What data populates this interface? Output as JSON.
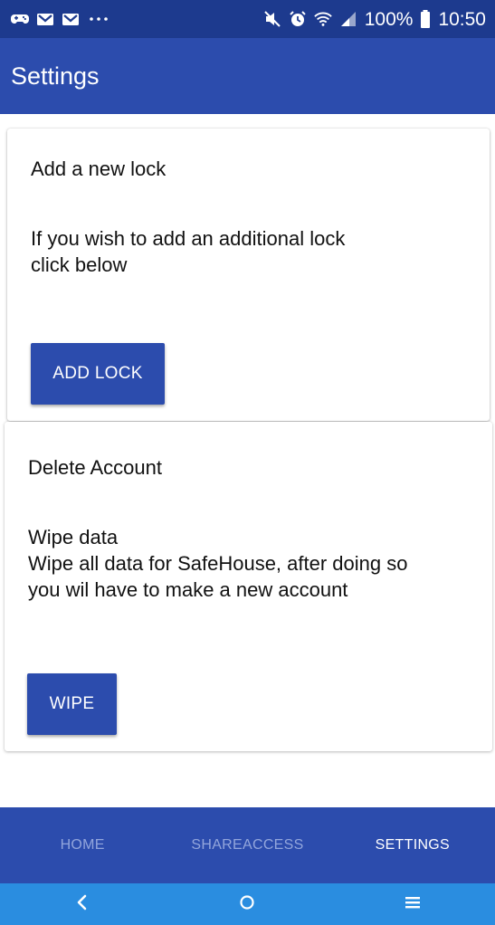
{
  "status_bar": {
    "left_icons": [
      "game-controller-icon",
      "gmail-icon",
      "gmail-icon",
      "more-notifications-icon"
    ],
    "right_icons": [
      "mute-icon",
      "alarm-icon",
      "wifi-icon",
      "signal-icon",
      "battery-icon"
    ],
    "battery": "100%",
    "time": "10:50"
  },
  "app_bar": {
    "title": "Settings"
  },
  "lock_card": {
    "heading": "Add a new lock",
    "body_line1": "If you wish to add an additional lock",
    "body_line2": "click below",
    "button_label": "ADD LOCK"
  },
  "delete_card": {
    "heading": "Delete Account",
    "subheading": "Wipe data",
    "body_line1": "Wipe all data for SafeHouse, after doing so",
    "body_line2": "you wil have to make a new account",
    "button_label": "WIPE"
  },
  "tabs": [
    {
      "label": "HOME",
      "active": false
    },
    {
      "label": "SHAREACCESS",
      "active": false
    },
    {
      "label": "SETTINGS",
      "active": true
    }
  ],
  "nav_bar": {
    "buttons": [
      "back-icon",
      "home-icon",
      "recents-icon"
    ]
  },
  "colors": {
    "primary": "#2c4cad",
    "status_bar": "#1d3a8e",
    "nav_bar": "#2a8de0",
    "inactive_tab": "#93a6dc"
  }
}
